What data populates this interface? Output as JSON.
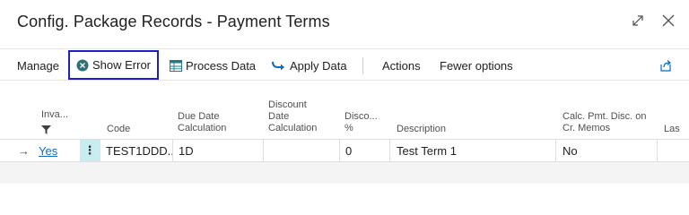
{
  "window": {
    "title": "Config. Package Records - Payment Terms",
    "expand_icon": "expand-diagonal-icon",
    "close_icon": "close-icon"
  },
  "actionbar": {
    "manage": "Manage",
    "show_error": "Show Error",
    "process_data": "Process Data",
    "apply_data": "Apply Data",
    "actions": "Actions",
    "fewer_options": "Fewer options",
    "share_icon": "share-icon"
  },
  "columns": {
    "invalid": "Inva...",
    "code": "Code",
    "due_date_l1": "Due Date",
    "due_date_l2": "Calculation",
    "disc_date_l1": "Discount",
    "disc_date_l2": "Date",
    "disc_date_l3": "Calculation",
    "disc_pct_l1": "Disco...",
    "disc_pct_l2": "%",
    "description": "Description",
    "calc_pmt_l1": "Calc. Pmt. Disc. on",
    "calc_pmt_l2": "Cr. Memos",
    "last": "Las"
  },
  "rows": [
    {
      "invalid": "Yes",
      "menu": "⋮",
      "code": "TEST1DDD...",
      "due_date": "1D",
      "disc_date": "",
      "disc_pct": "0",
      "description": "Test Term 1",
      "calc_pmt": "No"
    }
  ],
  "colors": {
    "accent": "#0f6cbd",
    "focus_border": "#1e1ec8",
    "selected_cell": "#c8ecf0",
    "error_icon": "#2e6f7a",
    "apply_icon": "#0f6cbd"
  }
}
